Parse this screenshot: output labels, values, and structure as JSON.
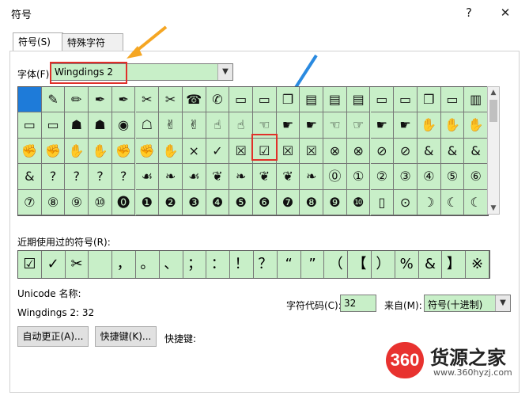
{
  "window": {
    "title": "符号",
    "help_btn": "?",
    "close_btn": "✕"
  },
  "tabs": [
    {
      "label": "符号(S)",
      "active": true
    },
    {
      "label": "特殊字符(P)",
      "active": false
    }
  ],
  "font": {
    "label": "字体(F):",
    "value": "Wingdings 2"
  },
  "symbol_grid": {
    "rows": [
      [
        "",
        "✎",
        "✏",
        "✒",
        "✒",
        "✂",
        "✂",
        "☎",
        "✆",
        "▭",
        "▭",
        "❐",
        "▤",
        "▤",
        "▤",
        "▭",
        "▭",
        "❐",
        "▭",
        "▥"
      ],
      [
        "▭",
        "▭",
        "☗",
        "☗",
        "◉",
        "☖",
        "✌",
        "✌",
        "☝",
        "☝",
        "☜",
        "☛",
        "☛",
        "☜",
        "☞",
        "☛",
        "☛",
        "✋",
        "✋",
        "✋"
      ],
      [
        "✊",
        "✊",
        "✋",
        "✋",
        "✊",
        "✊",
        "✋",
        "×",
        "✓",
        "☒",
        "☑",
        "☒",
        "☒",
        "⊗",
        "⊗",
        "⊘",
        "⊘",
        "&",
        "&",
        "&"
      ],
      [
        "&",
        "?",
        "?",
        "?",
        "?",
        "☙",
        "❧",
        "☙",
        "❦",
        "❧",
        "❦",
        "❦",
        "❧",
        "⓪",
        "①",
        "②",
        "③",
        "④",
        "⑤",
        "⑥"
      ],
      [
        "⑦",
        "⑧",
        "⑨",
        "⑩",
        "⓿",
        "❶",
        "❷",
        "❸",
        "❹",
        "❺",
        "❻",
        "❼",
        "❽",
        "❾",
        "❿",
        "▯",
        "⊙",
        "☽",
        "☾",
        "☾"
      ]
    ],
    "selected": {
      "row": 0,
      "col": 0
    }
  },
  "recent": {
    "label": "近期使用过的符号(R):",
    "items": [
      "☑",
      "✓",
      "✂",
      "",
      "，",
      "。",
      "、",
      "；",
      "：",
      "！",
      "？",
      "“",
      "”",
      "（",
      "【",
      "）",
      "%",
      "&",
      "】",
      "※"
    ]
  },
  "unicode": {
    "label": "Unicode 名称:",
    "value": "Wingdings 2: 32"
  },
  "char_code": {
    "label": "字符代码(C):",
    "value": "32"
  },
  "from": {
    "label": "来自(M):",
    "value": "符号(十进制)"
  },
  "buttons": {
    "autocorrect": "自动更正(A)...",
    "shortcut_key": "快捷键(K)...",
    "shortcut_label": "快捷键:"
  },
  "watermark": {
    "logo": "360",
    "name": "货源之家",
    "url": "www.360hyzj.com"
  },
  "colors": {
    "grid_bg": "#c8efc8",
    "selected": "#1e7bd9",
    "highlight": "#e0302a"
  }
}
